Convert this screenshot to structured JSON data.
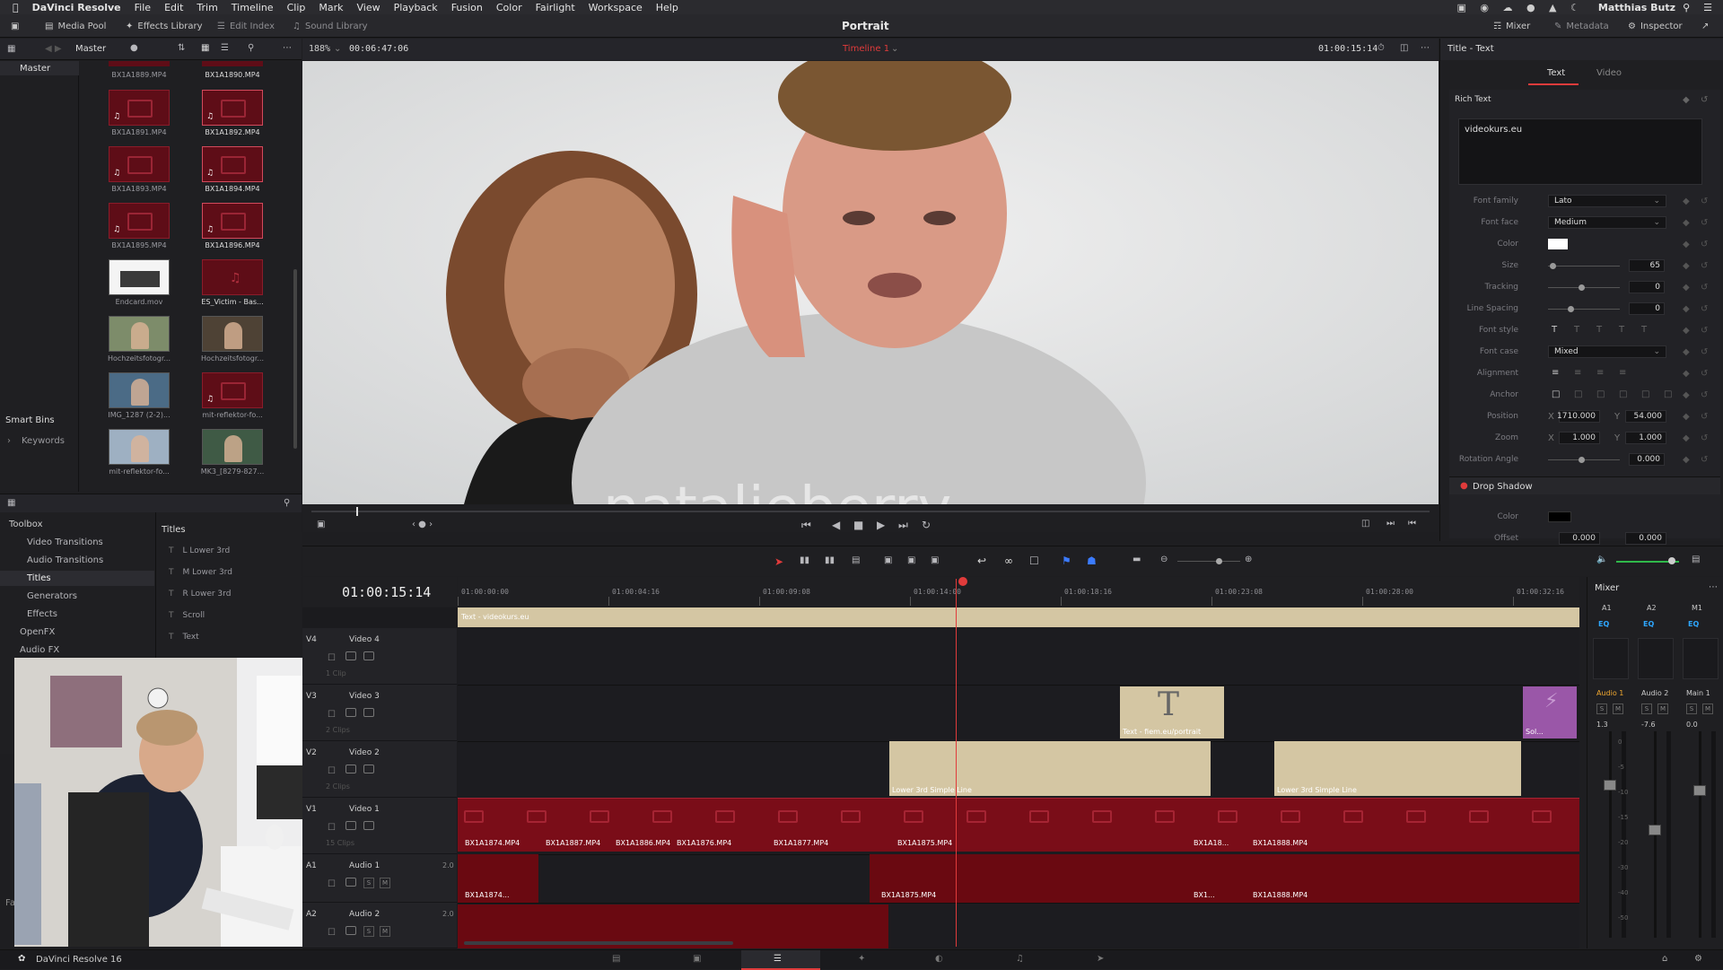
{
  "menubar": {
    "app": "DaVinci Resolve",
    "items": [
      "File",
      "Edit",
      "Trim",
      "Timeline",
      "Clip",
      "Mark",
      "View",
      "Playback",
      "Fusion",
      "Color",
      "Fairlight",
      "Workspace",
      "Help"
    ],
    "user": "Matthias Butz"
  },
  "toolbar": {
    "media_pool": "Media Pool",
    "effects_library": "Effects Library",
    "edit_index": "Edit Index",
    "sound_library": "Sound Library",
    "project_title": "Portrait",
    "mixer": "Mixer",
    "metadata": "Metadata",
    "inspector": "Inspector"
  },
  "viewer": {
    "bin": "Master",
    "zoom": "188%",
    "duration": "00:06:47:06",
    "timeline": "Timeline 1",
    "timecode": "01:00:15:14",
    "overlay_text": "natalieberry"
  },
  "bins": {
    "master": "Master",
    "smart_bins": "Smart Bins",
    "keywords": "Keywords"
  },
  "clips": [
    {
      "name": "BX1A1889.MP4",
      "kind": "red"
    },
    {
      "name": "BX1A1890.MP4",
      "kind": "red"
    },
    {
      "name": "BX1A1891.MP4",
      "kind": "red"
    },
    {
      "name": "BX1A1892.MP4",
      "kind": "red"
    },
    {
      "name": "BX1A1893.MP4",
      "kind": "red"
    },
    {
      "name": "BX1A1894.MP4",
      "kind": "red"
    },
    {
      "name": "BX1A1895.MP4",
      "kind": "red"
    },
    {
      "name": "BX1A1896.MP4",
      "kind": "red"
    },
    {
      "name": "Endcard.mov",
      "kind": "endcard"
    },
    {
      "name": "ES_Victim - Bas...",
      "kind": "audio"
    },
    {
      "name": "Hochzeitsfotogr...",
      "kind": "photo"
    },
    {
      "name": "Hochzeitsfotogr...",
      "kind": "photo2"
    },
    {
      "name": "IMG_1287 (2-2)...",
      "kind": "photo3"
    },
    {
      "name": "mit-reflektor-fo...",
      "kind": "red"
    },
    {
      "name": "mit-reflektor-fo...",
      "kind": "photo4"
    },
    {
      "name": "MK3_[8279-827...",
      "kind": "photo5"
    }
  ],
  "effects": {
    "toolbox": "Toolbox",
    "categories": [
      "Video Transitions",
      "Audio Transitions",
      "Titles",
      "Generators",
      "Effects"
    ],
    "openfx": "OpenFX",
    "audiofx": "Audio FX",
    "fav": "Fav",
    "titles_header": "Titles",
    "titles": [
      "L Lower 3rd",
      "M Lower 3rd",
      "R Lower 3rd",
      "Scroll",
      "Text"
    ]
  },
  "inspector": {
    "header": "Title - Text",
    "tabs": [
      "Text",
      "Video"
    ],
    "section": "Rich Text",
    "rich_text": "videokurs.eu",
    "font_family_label": "Font family",
    "font_family": "Lato",
    "font_face_label": "Font face",
    "font_face": "Medium",
    "color_label": "Color",
    "size_label": "Size",
    "size": "65",
    "tracking_label": "Tracking",
    "tracking": "0",
    "line_spacing_label": "Line Spacing",
    "line_spacing": "0",
    "font_style_label": "Font style",
    "font_case_label": "Font case",
    "font_case": "Mixed",
    "alignment_label": "Alignment",
    "anchor_label": "Anchor",
    "position_label": "Position",
    "pos_x": "1710.000",
    "pos_y": "54.000",
    "zoom_label": "Zoom",
    "zoom_x": "1.000",
    "zoom_y": "1.000",
    "rotation_label": "Rotation Angle",
    "rotation": "0.000",
    "drop_shadow": "Drop Shadow",
    "ds_color_label": "Color",
    "offset_label": "Offset",
    "offset_x": "0.000",
    "offset_y": "0.000",
    "x": "X",
    "y": "Y"
  },
  "timeline": {
    "timecode": "01:00:15:14",
    "ruler": [
      "01:00:00:00",
      "01:00:04:16",
      "01:00:09:08",
      "01:00:14:00",
      "01:00:18:16",
      "01:00:23:08",
      "01:00:28:00",
      "01:00:32:16"
    ],
    "tracks": [
      {
        "id": "V4",
        "name": "Video 4",
        "sub": "1 Clip"
      },
      {
        "id": "V3",
        "name": "Video 3",
        "sub": "2 Clips"
      },
      {
        "id": "V2",
        "name": "Video 2",
        "sub": "2 Clips"
      },
      {
        "id": "V1",
        "name": "Video 1",
        "sub": "15 Clips"
      },
      {
        "id": "A1",
        "name": "Audio 1",
        "level": "2.0"
      },
      {
        "id": "A2",
        "name": "Audio 2",
        "level": "2.0"
      }
    ],
    "text_clip": "Text - videokurs.eu",
    "v3_clip": "Text - fiem.eu/portrait",
    "v3_clip2": "Sol...",
    "v2_clip1": "Lower 3rd Simple Line",
    "v2_clip2": "Lower 3rd Simple Line",
    "v1_labels": [
      "BX1A1874.MP4",
      "BX1A1887.MP4",
      "BX1A1886.MP4",
      "BX1A1876.MP4",
      "BX1A1877.MP4",
      "BX1A1875.MP4",
      "BX1A18...",
      "BX1A1888.MP4"
    ],
    "a1_labels": [
      "BX1A1874...",
      "BX1A1875.MP4",
      "BX1...",
      "BX1A1888.MP4"
    ]
  },
  "mixer": {
    "title": "Mixer",
    "channels": [
      "A1",
      "A2",
      "M1"
    ],
    "eq": "EQ",
    "names": [
      "Audio 1",
      "Audio 2",
      "Main 1"
    ],
    "levels": [
      "1.3",
      "-7.6",
      "0.0"
    ],
    "s": "S",
    "m": "M",
    "scale": [
      "0",
      "-5",
      "-10",
      "-15",
      "-20",
      "-30",
      "-40",
      "-50"
    ]
  },
  "footer": {
    "version": "DaVinci Resolve 16"
  }
}
